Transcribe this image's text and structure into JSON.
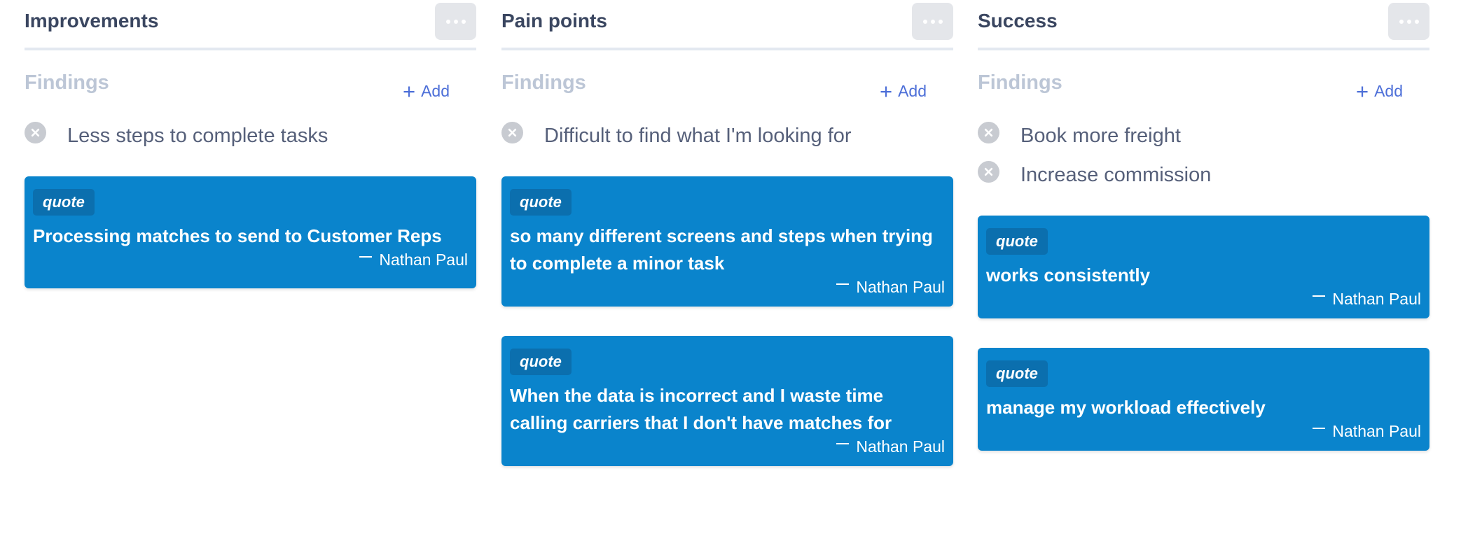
{
  "columns": [
    {
      "title": "Improvements",
      "findings_label": "Findings",
      "add_label": "Add",
      "findings": [
        "Less steps to complete tasks"
      ],
      "quotes": [
        {
          "tag": "quote",
          "text": "Processing matches to send to Customer Reps",
          "author": "Nathan Paul"
        }
      ]
    },
    {
      "title": "Pain points",
      "findings_label": "Findings",
      "add_label": "Add",
      "findings": [
        "Difficult to find what I'm looking for"
      ],
      "quotes": [
        {
          "tag": "quote",
          "text": "so many different screens and steps when trying to complete a minor task",
          "author": "Nathan Paul"
        },
        {
          "tag": "quote",
          "text": "When the data is incorrect and I waste time calling carriers that I don't have matches for",
          "author": "Nathan Paul"
        }
      ]
    },
    {
      "title": "Success",
      "findings_label": "Findings",
      "add_label": "Add",
      "findings": [
        "Book more freight",
        "Increase commission"
      ],
      "quotes": [
        {
          "tag": "quote",
          "text": "works consistently",
          "author": "Nathan Paul"
        },
        {
          "tag": "quote",
          "text": "manage my workload effectively",
          "author": "Nathan Paul"
        }
      ]
    }
  ],
  "colors": {
    "card": "#0a84cc",
    "tag": "#0b6fae",
    "accent": "#4d6fd8"
  }
}
